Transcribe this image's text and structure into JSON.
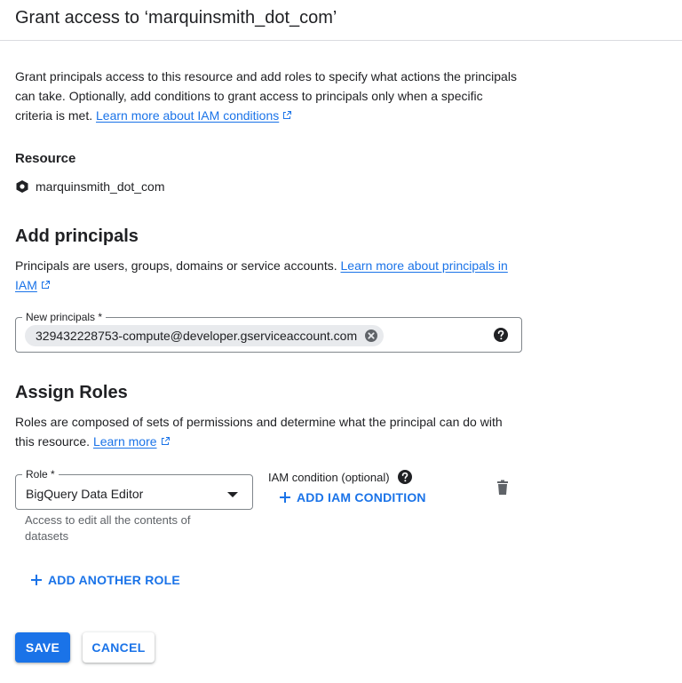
{
  "header": {
    "title": "Grant access to ‘marquinsmith_dot_com’"
  },
  "intro": {
    "text": "Grant principals access to this resource and add roles to specify what actions the principals can take. Optionally, add conditions to grant access to principals only when a specific criteria is met.",
    "link_label": "Learn more about IAM conditions"
  },
  "resource": {
    "label": "Resource",
    "name": "marquinsmith_dot_com",
    "icon": "project-hexagon-icon"
  },
  "add_principals": {
    "title": "Add principals",
    "description": "Principals are users, groups, domains or service accounts.",
    "link_label": "Learn more about principals in IAM",
    "field_label": "New principals *",
    "chips": [
      {
        "label": "329432228753-compute@developer.gserviceaccount.com"
      }
    ],
    "help_icon": "help-circle-icon"
  },
  "assign_roles": {
    "title": "Assign Roles",
    "description": "Roles are composed of sets of permissions and determine what the principal can do with this resource.",
    "link_label": "Learn more",
    "role_field_label": "Role *",
    "role_value": "BigQuery Data Editor",
    "role_hint": "Access to edit all the contents of datasets",
    "iam_condition_label": "IAM condition (optional)",
    "add_iam_condition_label": "ADD IAM CONDITION",
    "add_another_role_label": "ADD ANOTHER ROLE",
    "delete_icon": "trash-icon"
  },
  "actions": {
    "save_label": "SAVE",
    "cancel_label": "CANCEL"
  },
  "colors": {
    "accent": "#1a73e8",
    "text": "#202124",
    "secondary_text": "#5f6368",
    "border": "#80868b",
    "chip_bg": "#e8eaed"
  }
}
